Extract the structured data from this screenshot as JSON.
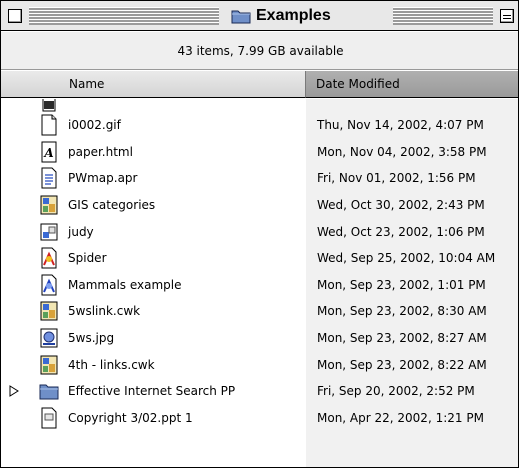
{
  "window": {
    "title": "Examples"
  },
  "status": {
    "summary": "43 items, 7.99 GB available"
  },
  "columns": {
    "name": "Name",
    "date": "Date Modified"
  },
  "rows": [
    {
      "name": "i0002.gif",
      "date": "Thu, Nov 14, 2002, 4:07 PM",
      "icon": "gif-document-icon"
    },
    {
      "name": "paper.html",
      "date": "Mon, Nov 04, 2002, 3:58 PM",
      "icon": "html-document-icon"
    },
    {
      "name": "PWmap.apr",
      "date": "Fri, Nov 01, 2002, 1:56 PM",
      "icon": "text-document-icon"
    },
    {
      "name": "GIS categories",
      "date": "Wed, Oct 30, 2002, 2:43 PM",
      "icon": "appleworks-document-icon"
    },
    {
      "name": "judy",
      "date": "Wed, Oct 23, 2002, 1:06 PM",
      "icon": "file-document-icon"
    },
    {
      "name": "Spider",
      "date": "Wed, Sep 25, 2002, 10:04 AM",
      "icon": "inspiration-document-icon"
    },
    {
      "name": "Mammals example",
      "date": "Mon, Sep 23, 2002, 1:01 PM",
      "icon": "inspiration-document-icon"
    },
    {
      "name": "5wslink.cwk",
      "date": "Mon, Sep 23, 2002, 8:30 AM",
      "icon": "appleworks-document-icon"
    },
    {
      "name": "5ws.jpg",
      "date": "Mon, Sep 23, 2002, 8:27 AM",
      "icon": "jpeg-document-icon"
    },
    {
      "name": "4th - links.cwk",
      "date": "Mon, Sep 23, 2002, 8:22 AM",
      "icon": "appleworks-document-icon"
    },
    {
      "name": "Effective Internet Search PP",
      "date": "Fri, Sep 20, 2002, 2:52 PM",
      "icon": "folder-icon"
    },
    {
      "name": "Copyright 3/02.ppt 1",
      "date": "Mon, Apr 22, 2002, 1:21 PM",
      "icon": "powerpoint-document-icon"
    }
  ],
  "colors": {
    "selected_column_header": "#a6a6a6",
    "date_column_band": "#f1f1f1",
    "folder_blue": "#6f8fc8"
  }
}
